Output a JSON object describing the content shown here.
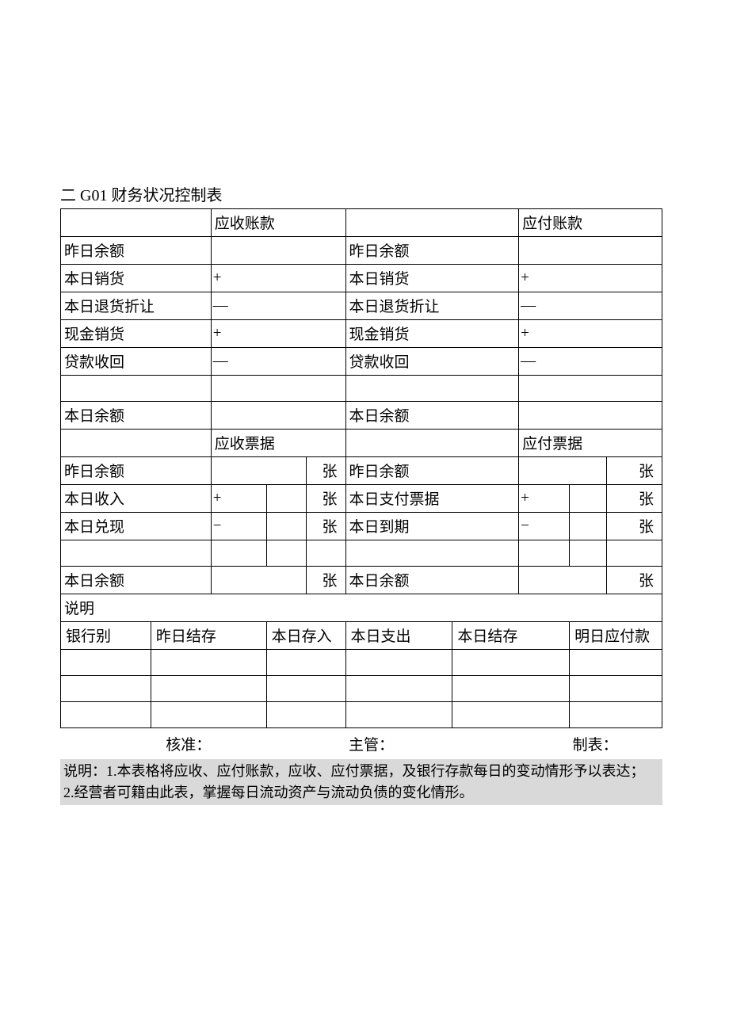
{
  "title": "二 G01 财务状况控制表",
  "headers": {
    "recv_acct": "应收账款",
    "pay_acct": "应付账款",
    "recv_note": "应收票据",
    "pay_note": "应付票据"
  },
  "rows": {
    "yesterday_balance": "昨日余额",
    "today_sales": "本日销货",
    "today_return": "本日退货折让",
    "cash_sales": "现金销货",
    "loan_recovery": "贷款收回",
    "today_balance": "本日余额",
    "today_income": "本日收入",
    "today_pay_note": "本日支付票据",
    "today_cash": "本日兑现",
    "today_due": "本日到期",
    "description": "说明"
  },
  "signs": {
    "plus": "+",
    "minus": "−",
    "dash": "—",
    "dash2": "―"
  },
  "unit": "张",
  "bank_table": {
    "bank": "银行别",
    "yesterday_deposit": "昨日结存",
    "today_deposit": "本日存入",
    "today_expense": "本日支出",
    "today_balance": "本日结存",
    "tomorrow_payable": "明日应付款"
  },
  "signatures": {
    "approve": "核准：",
    "supervisor": "主管：",
    "preparer": "制表："
  },
  "notes": {
    "line1": "说明：1.本表格将应收、应付账款，应收、应付票据，及银行存款每日的变动情形予以表达；",
    "line2": "2.经营者可籍由此表，掌握每日流动资产与流动负债的变化情形。"
  }
}
